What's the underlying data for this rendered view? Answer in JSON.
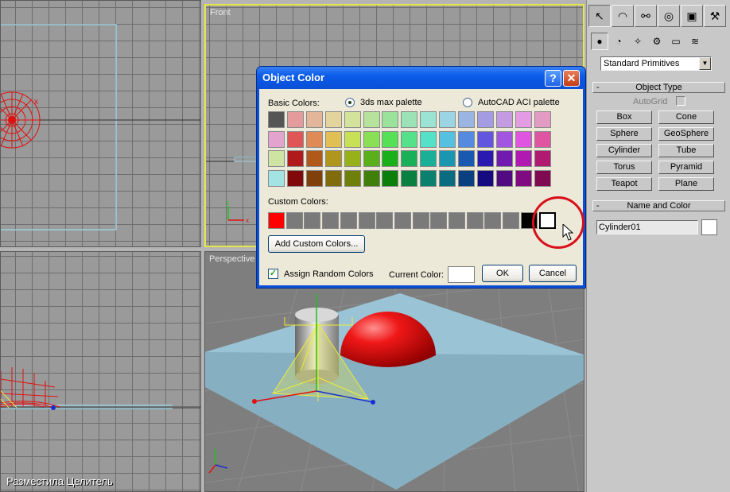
{
  "viewports": {
    "front_label": "Front",
    "perspective_label": "Perspective"
  },
  "panel": {
    "tabs": [
      "select-icon",
      "shapes-icon",
      "hierarchy-icon",
      "motion-icon",
      "display-icon",
      "utilities-icon"
    ],
    "subtabs": [
      "geometry-icon",
      "light-icon",
      "camera-icon",
      "helper-icon",
      "spacewarp-icon",
      "systems-icon"
    ],
    "dropdown_value": "Standard Primitives",
    "object_type": {
      "header": "Object Type",
      "minus": "-",
      "autogrid_label": "AutoGrid",
      "buttons": [
        "Box",
        "Cone",
        "Sphere",
        "GeoSphere",
        "Cylinder",
        "Tube",
        "Torus",
        "Pyramid",
        "Teapot",
        "Plane"
      ]
    },
    "name_and_color": {
      "header": "Name and Color",
      "minus": "-",
      "name_value": "Cylinder01",
      "color": "#ffffff"
    }
  },
  "dialog": {
    "title": "Object Color",
    "help_label": "?",
    "close_label": "✕",
    "basic_colors_label": "Basic Colors:",
    "radio_3ds": "3ds max palette",
    "radio_aci": "AutoCAD ACI palette",
    "selected_palette": "3ds max palette",
    "basic_colors": [
      [
        "#555555",
        "#e39b9b",
        "#e3b59b",
        "#e3d49b",
        "#d3e39b",
        "#b6e39b",
        "#9be39b",
        "#9be3b6",
        "#9be3d3",
        "#9bd4e3",
        "#9bb5e3",
        "#a59be3",
        "#c49be3",
        "#e39be3",
        "#e39bc4"
      ],
      [
        "#e3a3cf",
        "#e05555",
        "#e08a55",
        "#e0c055",
        "#c8e055",
        "#8ae055",
        "#55e055",
        "#55e08a",
        "#55e0c8",
        "#55c0e0",
        "#558ae0",
        "#6355e0",
        "#a255e0",
        "#e055e0",
        "#e055a2"
      ],
      [
        "#cfe3a3",
        "#b01a1a",
        "#b0591a",
        "#b0961a",
        "#98b01a",
        "#59b01a",
        "#1ab01a",
        "#1ab059",
        "#1ab098",
        "#1a96b0",
        "#1a59b0",
        "#2a1ab0",
        "#711ab0",
        "#b01ab0",
        "#b01a71"
      ],
      [
        "#a3e3e3",
        "#800a0a",
        "#80400a",
        "#806c0a",
        "#6e800a",
        "#40800a",
        "#0a800a",
        "#0a8040",
        "#0a806e",
        "#0a6c80",
        "#0a4080",
        "#160a80",
        "#520a80",
        "#800a80",
        "#800a52"
      ]
    ],
    "custom_colors_label": "Custom Colors:",
    "custom_colors": [
      "#ff0000",
      "#7a7a7a",
      "#7a7a7a",
      "#7a7a7a",
      "#7a7a7a",
      "#7a7a7a",
      "#7a7a7a",
      "#7a7a7a",
      "#7a7a7a",
      "#7a7a7a",
      "#7a7a7a",
      "#7a7a7a",
      "#7a7a7a",
      "#7a7a7a",
      "#000000",
      "#ffffff"
    ],
    "add_custom_label": "Add Custom Colors...",
    "assign_random_label": "Assign Random Colors",
    "assign_random_checked": true,
    "current_color_label": "Current Color:",
    "current_color": "#ffffff",
    "ok_label": "OK",
    "cancel_label": "Cancel"
  },
  "watermark": "Разместила Целитель"
}
